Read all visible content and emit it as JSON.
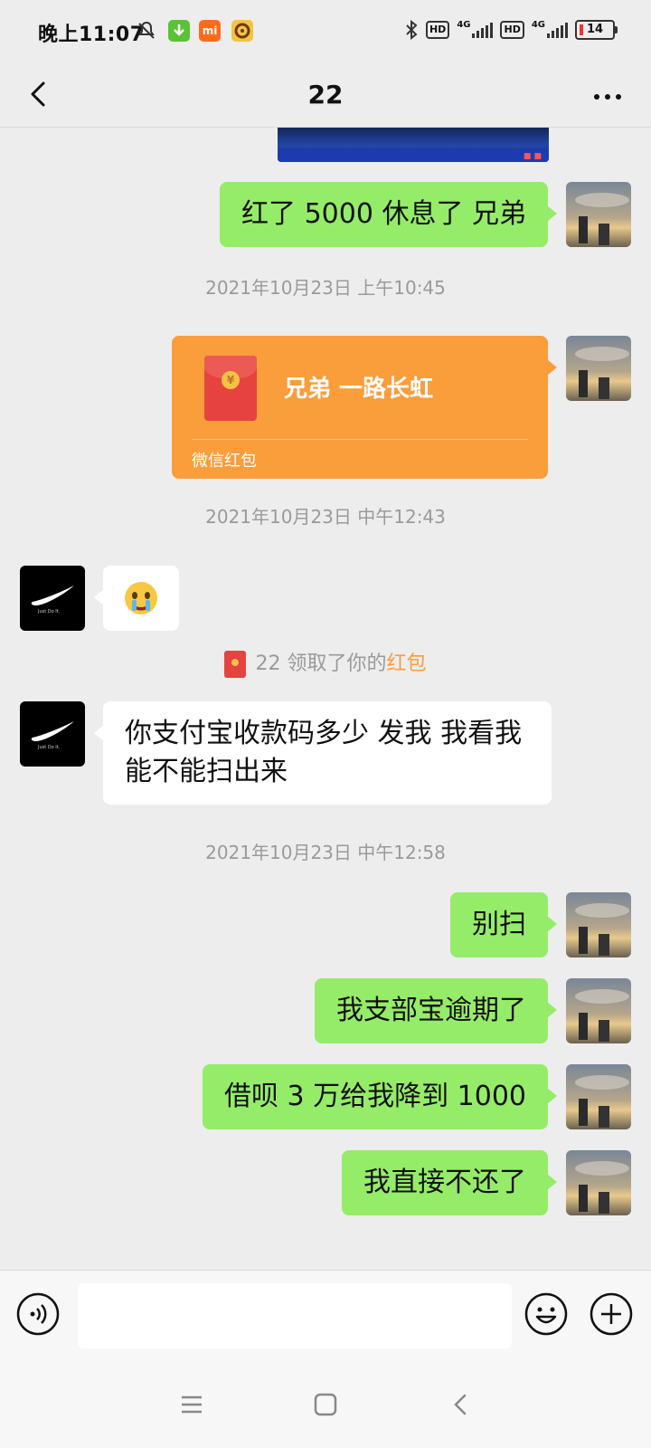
{
  "status_bar": {
    "time": "晚上11:07",
    "battery": "14",
    "network_1": "4G",
    "network_2": "4G",
    "hd": "HD"
  },
  "nav": {
    "title": "22"
  },
  "messages": {
    "m1": "红了 5000 休息了 兄弟",
    "ts1": "2021年10月23日 上午10:45",
    "redpacket_title": "兄弟 一路长虹",
    "redpacket_label": "微信红包",
    "ts2": "2021年10月23日 中午12:43",
    "sys_prefix": "22 领取了你的",
    "sys_highlight": "红包",
    "m3": "你支付宝收款码多少 发我 我看我能不能扫出来",
    "ts3": "2021年10月23日 中午12:58",
    "m4": "别扫",
    "m5": "我支部宝逾期了",
    "m6": "借呗 3 万给我降到 1000",
    "m7": "我直接不还了"
  },
  "colors": {
    "me_bubble": "#95ec69",
    "other_bubble": "#ffffff",
    "redpacket": "#fa9d3b",
    "background": "#ededed"
  },
  "icons": [
    "back-icon",
    "more-icon",
    "voice-icon",
    "emoji-icon",
    "plus-icon",
    "crying-emoji-icon",
    "red-packet-icon",
    "menu-icon",
    "home-icon",
    "back-nav-icon",
    "nike-swoosh-icon"
  ]
}
